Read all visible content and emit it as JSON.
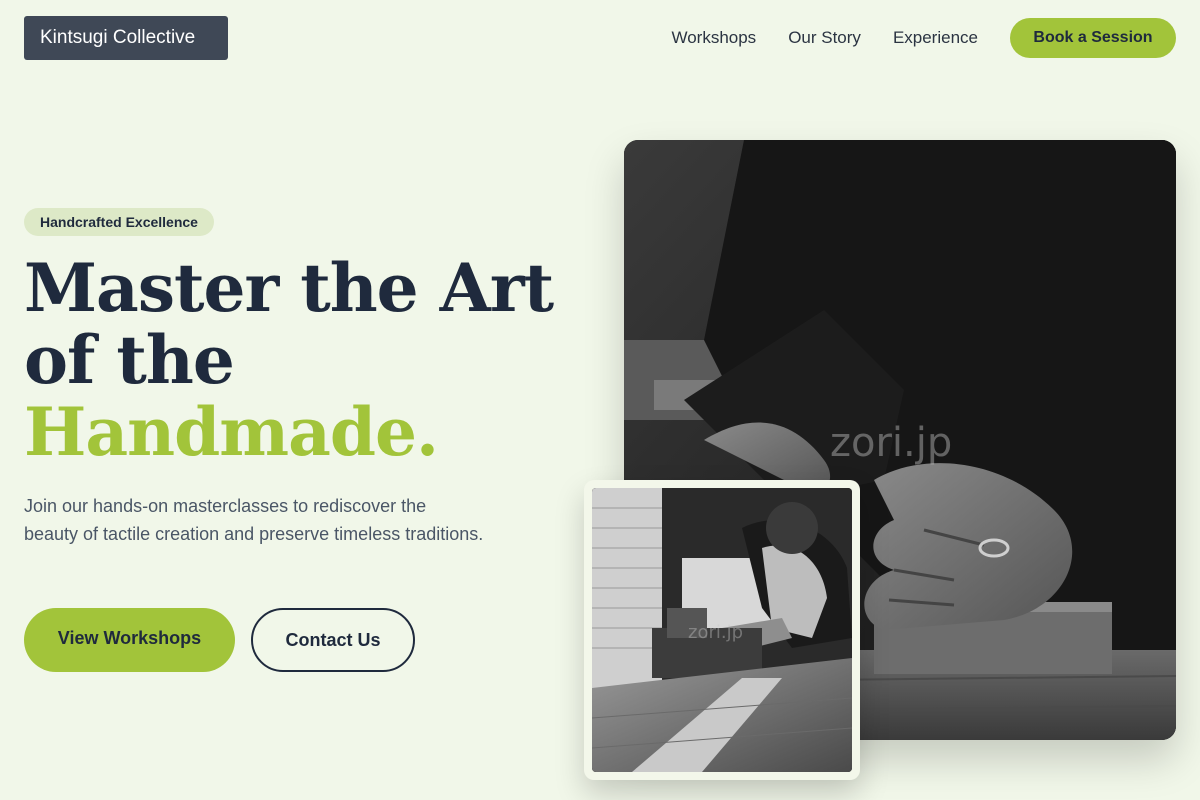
{
  "header": {
    "logo": "Kintsugi Collective",
    "nav": [
      "Workshops",
      "Our Story",
      "Experience"
    ],
    "cta": "Book a Session"
  },
  "hero": {
    "badge": "Handcrafted Excellence",
    "headline_line1": "Master the Art",
    "headline_line2": "of the",
    "headline_accent": "Handmade.",
    "lede": "Join our hands-on masterclasses to rediscover the beauty of tactile creation and preserve timeless traditions.",
    "primary_button": "View Workshops",
    "secondary_button": "Contact Us"
  },
  "images": {
    "main_watermark": "zori.jp",
    "small_watermark": "zori.jp"
  },
  "colors": {
    "background": "#f1f7e9",
    "accent": "#a2c43a",
    "dark": "#1f2a3d",
    "logo_bg": "#3f4856",
    "badge_bg": "#dde9c7"
  }
}
